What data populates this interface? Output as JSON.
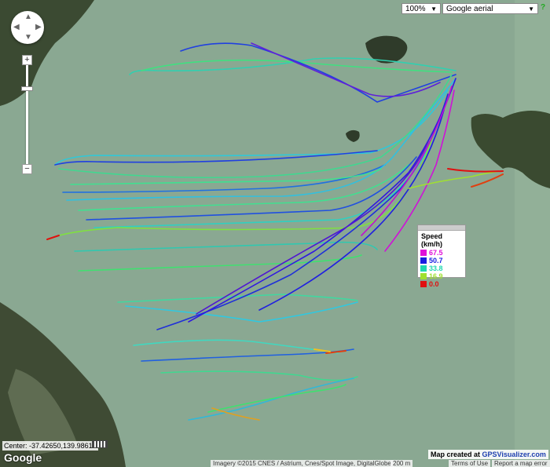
{
  "controls": {
    "zoom_select": "100%",
    "map_type_select": "Google aerial",
    "help": "?"
  },
  "legend": {
    "title": "Speed (km/h)",
    "items": [
      {
        "label": "67.5",
        "color": "#e010d8"
      },
      {
        "label": "50.7",
        "color": "#1a1ee0"
      },
      {
        "label": "33.8",
        "color": "#20d8b0"
      },
      {
        "label": "16.9",
        "color": "#a0e030"
      },
      {
        "label": "0.0",
        "color": "#e01010"
      }
    ]
  },
  "footer": {
    "center": "Center: -37.42650,139.98613",
    "logo": "Google",
    "imagery": "Imagery ©2015 CNES / Astrium, Cnes/Spot Image, DigitalGlobe",
    "scale": "200 m",
    "terms": "Terms of Use",
    "report": "Report a map error",
    "created_prefix": "Map created at ",
    "created_brand": "GPSVisualizer.com"
  },
  "colors": {
    "water": "#8aa892",
    "land": "#3b4a32"
  }
}
